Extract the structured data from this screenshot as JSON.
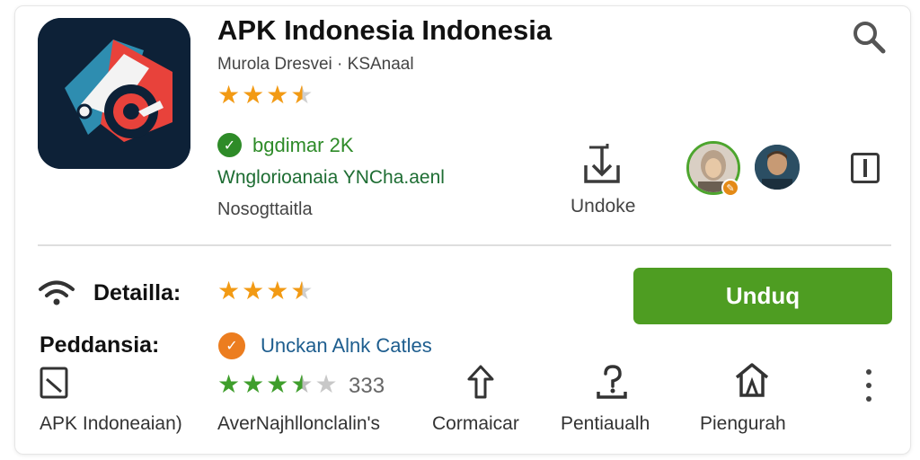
{
  "app": {
    "title": "APK Indonesia Indonesia",
    "subtitle": "Murola Dresvei · KSAnaal",
    "rating_stars": [
      1,
      1,
      1,
      0.5,
      0
    ],
    "verified_text": "bgdimar 2K",
    "link_text": "Wnglorioanaia YNCha.aenl",
    "muted_text": "Nosogttaitla"
  },
  "header_actions": {
    "download_label": "Undoke",
    "icons": [
      "search-icon",
      "download-icon",
      "avatar",
      "more-icon"
    ]
  },
  "details": {
    "label": "Detailla:",
    "rating_stars": [
      1,
      1,
      1,
      0.5,
      0
    ],
    "install_button": "Unduq",
    "developer_label": "Peddansia:",
    "developer_link": "Unckan Alnk Catles",
    "developer_icon_glyph": "✓",
    "review_stars": [
      1,
      1,
      1,
      0.5,
      0
    ],
    "review_count": "333"
  },
  "bottom_actions": [
    {
      "name": "apk",
      "label": "APK Indoneaian)",
      "icon": "square-edit-icon"
    },
    {
      "name": "avg",
      "label": "AverNajhllonclalin's",
      "icon": "none"
    },
    {
      "name": "compare",
      "label": "Cormaicar",
      "icon": "share-icon"
    },
    {
      "name": "settings",
      "label": "Pentiaualh",
      "icon": "question-icon"
    },
    {
      "name": "manage",
      "label": "Piengurah",
      "icon": "home-icon"
    }
  ],
  "colors": {
    "accent_green": "#4e9d22",
    "star_orange": "#f29a14",
    "link_blue": "#1d5d8e",
    "verified_green": "#2e8b28"
  }
}
